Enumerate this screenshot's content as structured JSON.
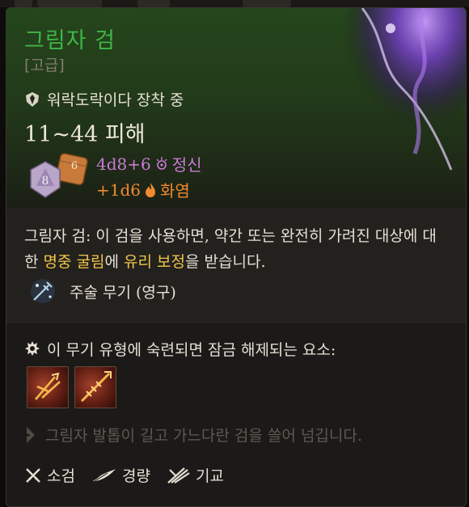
{
  "item": {
    "name": "그림자 검",
    "rarity": "[고급]",
    "equipped_text": "워락도락이다 장착 중",
    "damage_range": "11~44 피해"
  },
  "dice": {
    "d8_label": "8",
    "d6_label": "6"
  },
  "damage_lines": [
    {
      "formula": "4d8+6",
      "type": "정신",
      "color": "#c97ad6",
      "icon": "psychic-icon"
    },
    {
      "formula": "+1d6",
      "type": "화염",
      "color": "#f08a2e",
      "icon": "fire-icon"
    }
  ],
  "description": {
    "prefix": "그림자 검: 이 검을 사용하면, 약간 또는 완전히 가려진 대상에 대한 ",
    "highlight1": "명중 굴림",
    "middle": "에 ",
    "highlight2": "유리 보정",
    "suffix": "을 받습니다."
  },
  "spell_tag": "주술 무기 (영구)",
  "proficiency": {
    "text": "이 무기 유형에 숙련되면 잠금 해제되는 요소:",
    "actions": [
      "action-icon-1",
      "action-icon-2"
    ]
  },
  "lore": "그림자 발톱이 길고 가느다란 검을 쓸어 넘깁니다.",
  "tags": [
    {
      "label": "소검",
      "icon": "crossed-daggers-icon"
    },
    {
      "label": "경량",
      "icon": "feather-icon"
    },
    {
      "label": "기교",
      "icon": "finesse-icon"
    }
  ],
  "colors": {
    "title": "#3fb548",
    "gold_keyword": "#f0c64a",
    "psychic": "#c97ad6",
    "fire": "#f08a2e"
  }
}
